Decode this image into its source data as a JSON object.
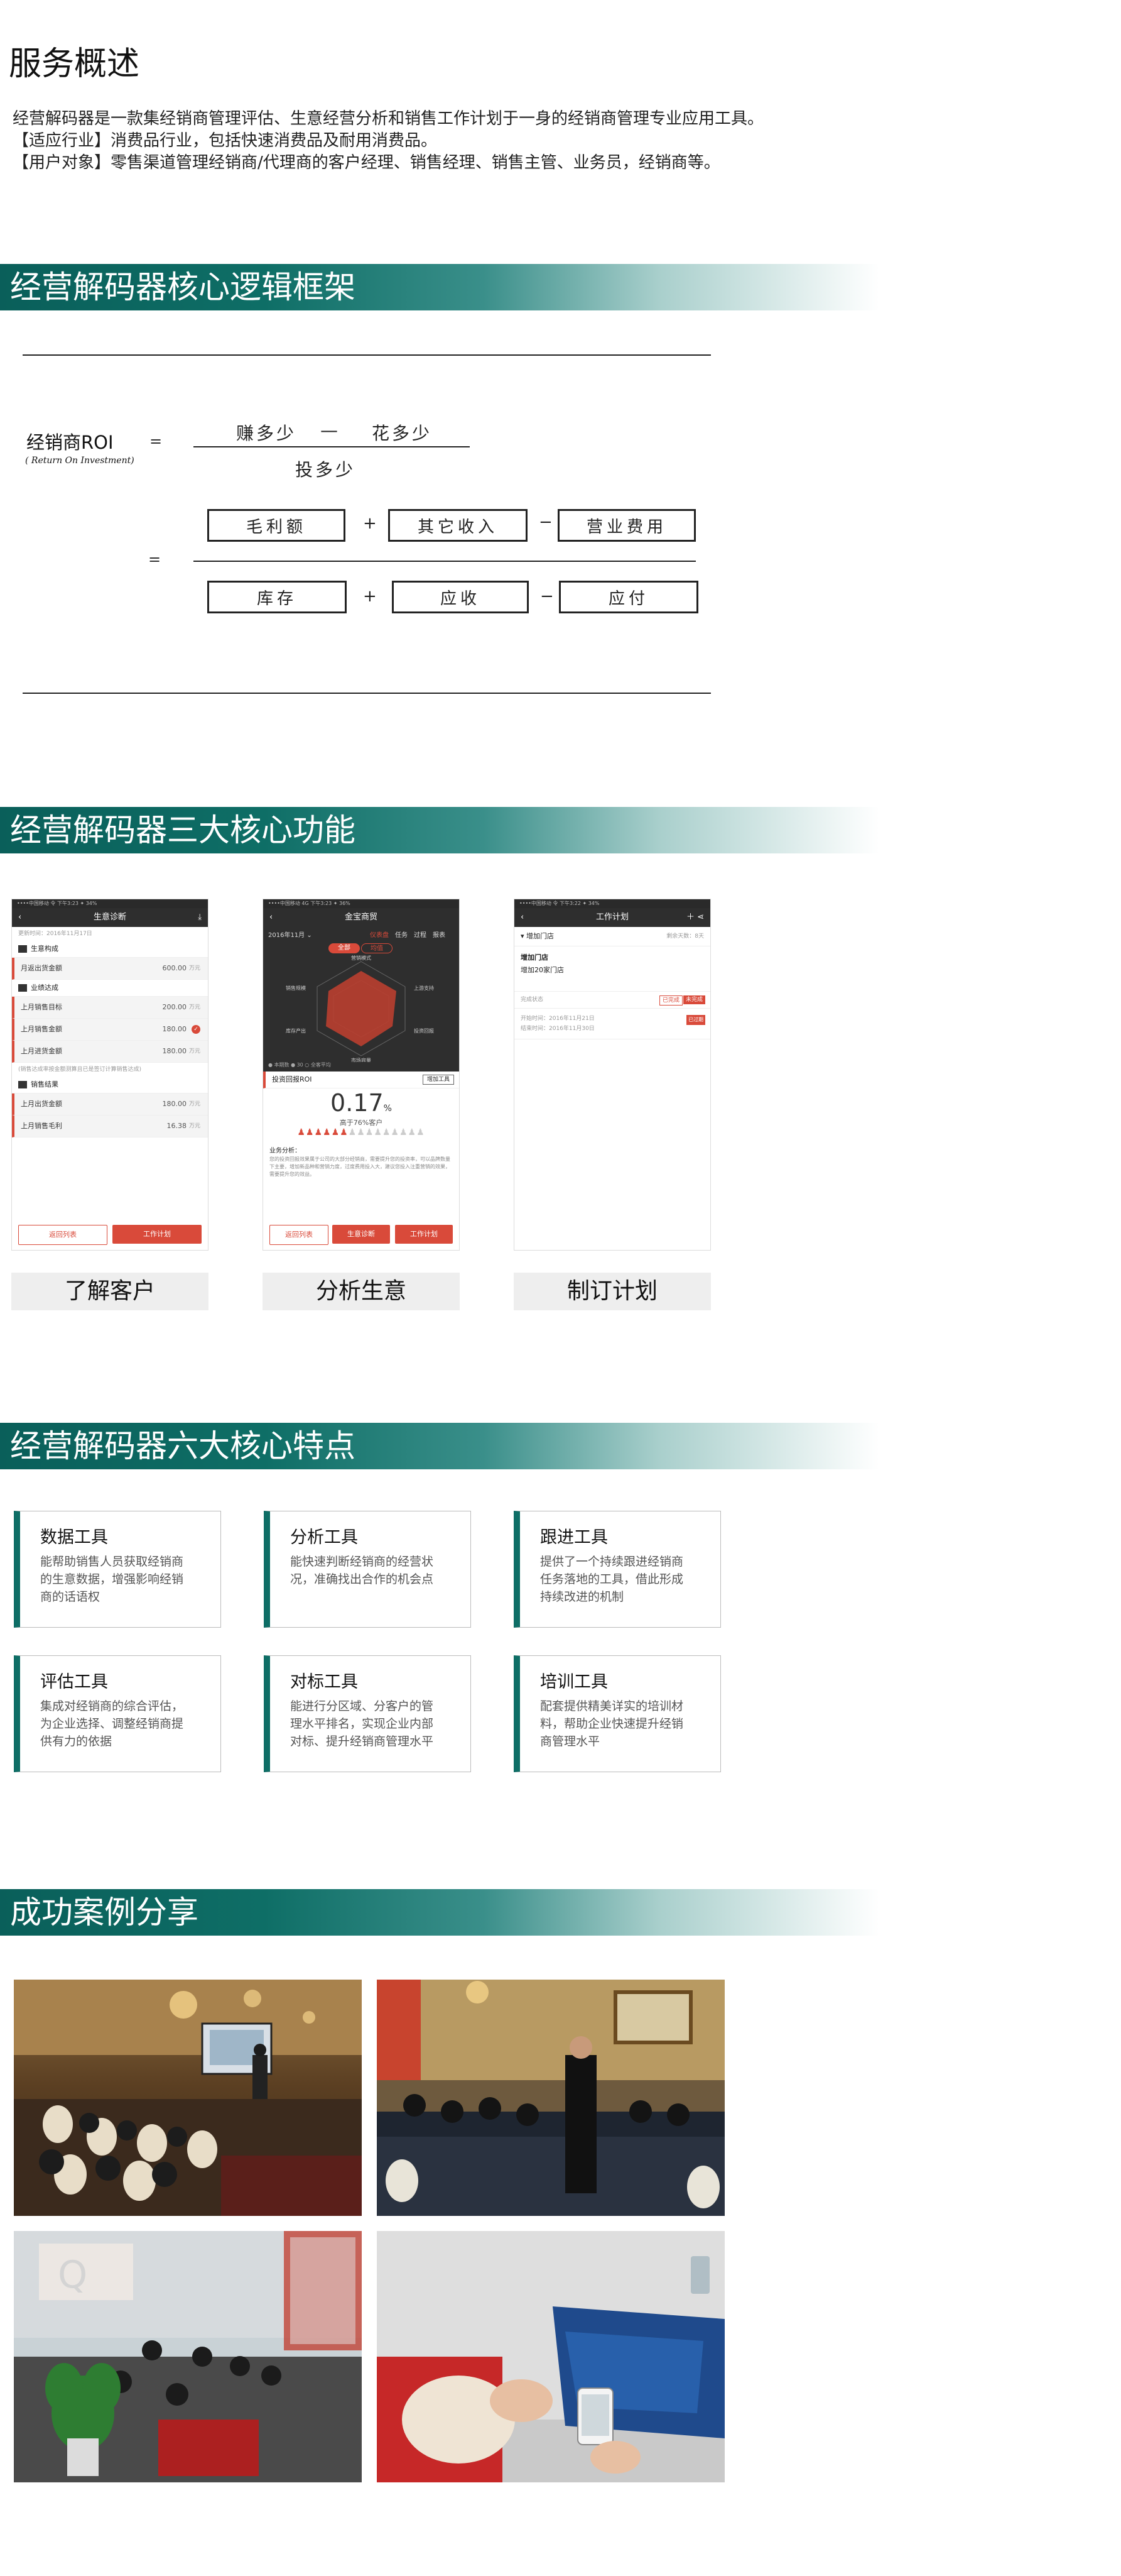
{
  "overview": {
    "title": "服务概述",
    "lines": [
      "经营解码器是一款集经销商管理评估、生意经营分析和销售工作计划于一身的经销商管理专业应用工具。",
      "【适应行业】消费品行业，包括快速消费品及耐用消费品。",
      "【用户对象】零售渠道管理经销商/代理商的客户经理、销售经理、销售主管、业务员，经销商等。"
    ]
  },
  "sections": {
    "framework": "经营解码器核心逻辑框架",
    "functions": "经营解码器三大核心功能",
    "features": "经营解码器六大核心特点",
    "cases": "成功案例分享"
  },
  "formula": {
    "roi_label": "经销商ROI",
    "roi_sub": "( Return On Investment)",
    "equals": "=",
    "earn": "赚多少",
    "minus_sign": "—",
    "spend": "花多少",
    "invest": "投多少",
    "plus": "+",
    "minus": "−",
    "numerator": [
      "毛利额",
      "其它收入",
      "营业费用"
    ],
    "denominator": [
      "库存",
      "应收",
      "应付"
    ]
  },
  "phones": {
    "p1": {
      "status": "••••中国移动  令     下午3:23        ✦ 34%",
      "title": "生意诊断",
      "back": "‹",
      "meta": "更新时间：2016年11月17日",
      "sec1": "生意构成",
      "row_a": {
        "label": "月返出货金额",
        "value": "600.00",
        "unit": "万元"
      },
      "sec2": "业绩达成",
      "rows": [
        {
          "label": "上月销售目标",
          "value": "200.00",
          "unit": "万元"
        },
        {
          "label": "上月销售金额",
          "value": "180.00",
          "unit": "万元"
        },
        {
          "label": "上月进货金额",
          "value": "180.00",
          "unit": "万元"
        }
      ],
      "note": "(销售达成率按金额测算且已是签订计算销售达成)",
      "sec3": "销售结果",
      "rows2": [
        {
          "label": "上月出货金额",
          "value": "180.00",
          "unit": "万元"
        },
        {
          "label": "上月销售毛利",
          "value": "16.38",
          "unit": "万元"
        }
      ],
      "btn_back": "返回列表",
      "btn_plan": "工作计划"
    },
    "p2": {
      "status": "••••中国移动  4G       下午3:23        ✦ 36%",
      "title": "金宝商贸",
      "month": "2016年11月 ⌄",
      "tabs": [
        "仪表盘",
        "任务",
        "过程",
        "报表"
      ],
      "toggle": [
        "全部",
        "均值"
      ],
      "roi_label": "投资回报ROI",
      "roi_btn": "增加工具",
      "roi_value": "0.17",
      "roi_unit": "%",
      "rank": "高于76%客户",
      "analysis_title": "业务分析：",
      "analysis": "您的投资回报效果属于公司的大部分经销商，需要提升您的投资率，可以品牌数量下主要，增加新品种和营销力度，过度费用投入大，建议您投入注重营销的效果，需要提升您的效益。",
      "btn_back": "返回列表",
      "btn_diag": "生意诊断",
      "btn_plan": "工作计划",
      "radar_labels": [
        "营销模式",
        "销售规模",
        "库存产出",
        "市场容量",
        "投资回报",
        "上游支持"
      ],
      "legend": "● 本期数   ● 30   ○ 全客平均"
    },
    "p3": {
      "status": "••••中国移动  令     下午3:22        ✦ 34%",
      "title": "工作计划",
      "sec": "增加门店",
      "sec_meta": "剩余天数：8天",
      "item_title": "增加门店",
      "item_desc": "增加20家门店",
      "status_label": "完成状态",
      "status_a": "已完成",
      "status_b": "未完成",
      "start": "开始时间：2016年11月21日",
      "end": "结束时间：2016年11月30日",
      "tag": "已过期"
    }
  },
  "captions": [
    "了解客户",
    "分析生意",
    "制订计划"
  ],
  "features": [
    {
      "title": "数据工具",
      "desc": [
        "能帮助销售人员获取经销商",
        "的生意数据，增强影响经销",
        "商的话语权"
      ]
    },
    {
      "title": "分析工具",
      "desc": [
        "能快速判断经销商的经营状",
        "况，准确找出合作的机会点"
      ]
    },
    {
      "title": "跟进工具",
      "desc": [
        "提供了一个持续跟进经销商",
        "任务落地的工具，借此形成",
        "持续改进的机制"
      ]
    },
    {
      "title": "评估工具",
      "desc": [
        "集成对经销商的综合评估，",
        "为企业选择、调整经销商提",
        "供有力的依据"
      ]
    },
    {
      "title": "对标工具",
      "desc": [
        "能进行分区域、分客户的管",
        "理水平排名，实现企业内部",
        "对标、提升经销商管理水平"
      ]
    },
    {
      "title": "培训工具",
      "desc": [
        "配套提供精美详实的培训材",
        "料，帮助企业快速提升经销",
        "商管理水平"
      ]
    }
  ],
  "colors": {
    "accent": "#0e6e66",
    "red": "#d94a3a"
  }
}
